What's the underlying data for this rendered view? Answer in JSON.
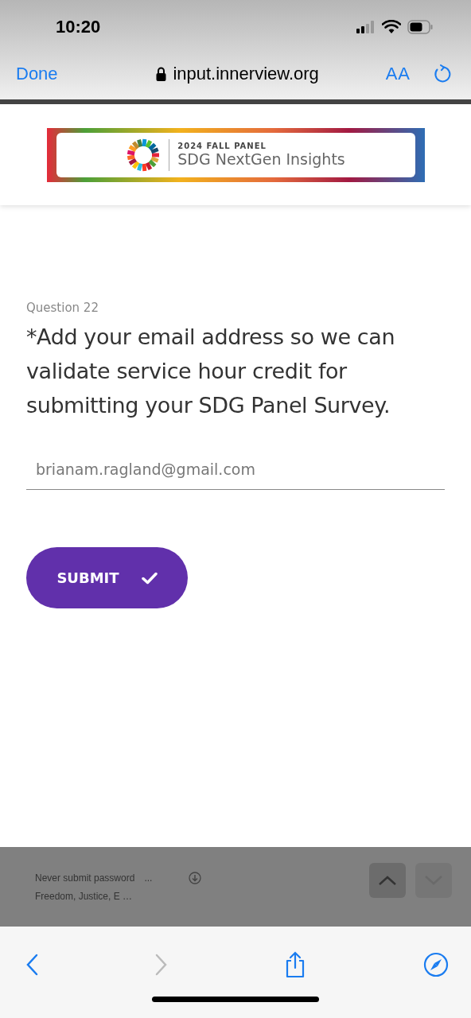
{
  "status_bar": {
    "time": "10:20"
  },
  "browser_bar": {
    "done": "Done",
    "url": "input.innerview.org",
    "text_size": "AA"
  },
  "banner": {
    "eyebrow": "2024 FALL PANEL",
    "title": "SDG NextGen Insights"
  },
  "question": {
    "number": "Question 22",
    "text": "*Add your email address so we can validate service hour credit for submitting your SDG Panel Survey."
  },
  "email_field": {
    "value": "brianam.ragland@gmail.com"
  },
  "submit_button": {
    "label": "SUBMIT"
  },
  "autofill_bar": {
    "suggestions": [
      "Never submit password",
      "Freedom, Justice, E …"
    ],
    "more": "...",
    "previous_disabled": false,
    "next_disabled": true
  },
  "toolbar": {
    "back_disabled": false,
    "forward_disabled": true
  }
}
